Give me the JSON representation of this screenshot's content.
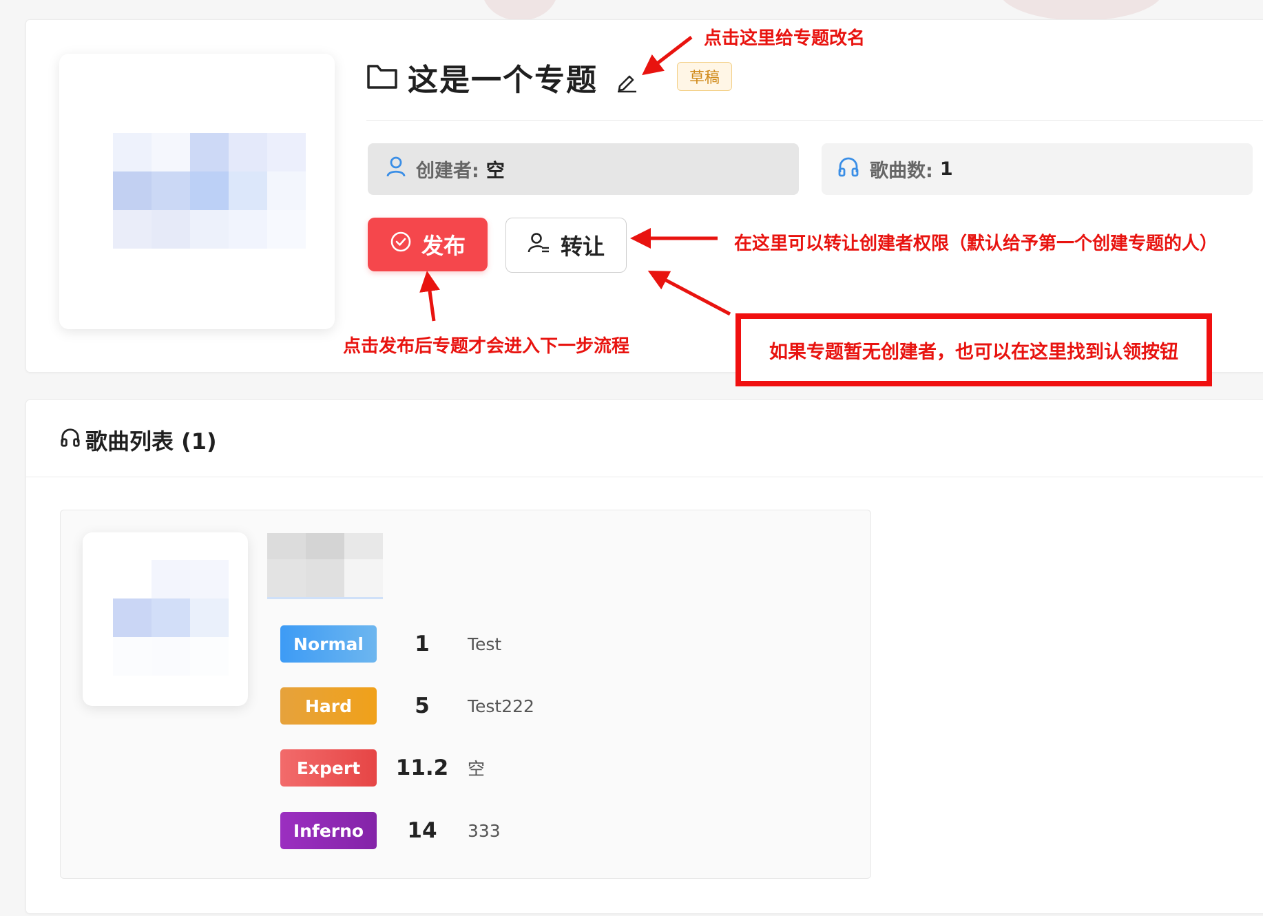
{
  "topic": {
    "title": "这是一个专题",
    "status_badge": "草稿",
    "creator_label": "创建者:",
    "creator_value": "空",
    "song_count_label": "歌曲数:",
    "song_count_value": "1",
    "publish_label": "发布",
    "transfer_label": "转让"
  },
  "annotations": {
    "rename_hint": "点击这里给专题改名",
    "transfer_hint": "在这里可以转让创建者权限（默认给予第一个创建专题的人）",
    "publish_hint": "点击发布后专题才会进入下一步流程",
    "claim_hint": "如果专题暂无创建者，也可以在这里找到认领按钮"
  },
  "song_list": {
    "header": "歌曲列表 (1)",
    "songs": [
      {
        "difficulties": [
          {
            "name": "Normal",
            "level": "1",
            "charter": "Test",
            "color": "#4fa3ef"
          },
          {
            "name": "Hard",
            "level": "5",
            "charter": "Test222",
            "color": "#eba22e"
          },
          {
            "name": "Expert",
            "level": "11.2",
            "charter": "空",
            "color": "#ec5a5a"
          },
          {
            "name": "Inferno",
            "level": "14",
            "charter": "333",
            "color": "#8c2bb4"
          }
        ]
      }
    ]
  },
  "colors": {
    "accent_red": "#f5474c",
    "annotation_red": "#e8130f",
    "icon_blue": "#3a8ee6"
  }
}
